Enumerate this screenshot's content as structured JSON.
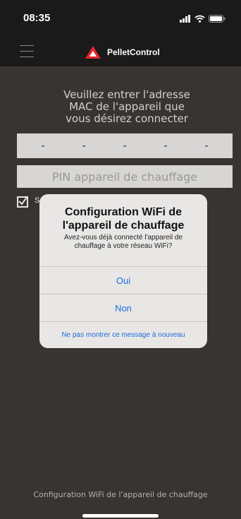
{
  "status_bar": {
    "time": "08:35",
    "icons": [
      "signal-icon",
      "wifi-icon",
      "battery-icon"
    ]
  },
  "nav": {
    "app_name": "PelletControl"
  },
  "form": {
    "prompt": "Veuillez entrer l'adresse\nMAC de l'appareil que\nvous désirez connecter",
    "mac_segments": [
      "-",
      "-",
      "-",
      "-",
      "-"
    ],
    "pin_placeholder": "PIN appareil de chauffage",
    "checkbox_label": "S"
  },
  "dialog": {
    "title": "Configuration WiFi de\nl'appareil de chauffage",
    "message": "Avez-vous déjà connecté l'appareil de chauffage à votre réseau WiFi?",
    "yes_label": "Oui",
    "no_label": "Non",
    "dont_show_label": "Ne pas montrer ce message à nouveau"
  },
  "footer": {
    "text": "Configuration WiFi de l'appareil de chauffage"
  },
  "colors": {
    "accent": "#1c6be0",
    "logo_red": "#e5262b",
    "background": "#383432"
  }
}
